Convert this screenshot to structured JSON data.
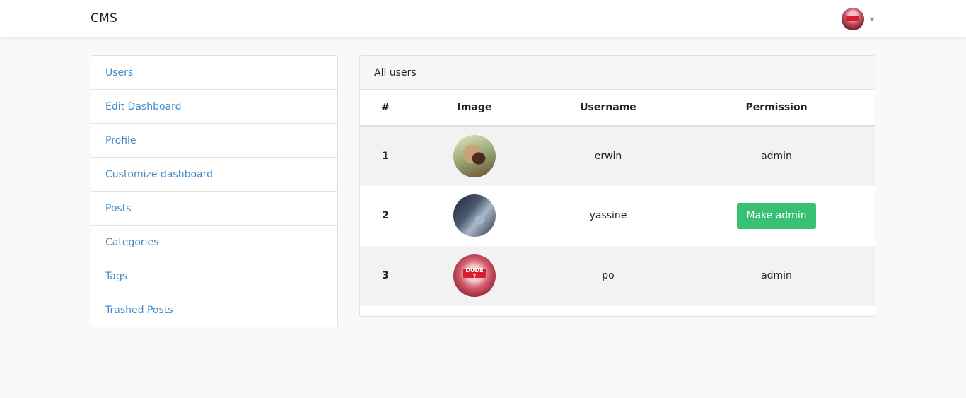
{
  "navbar": {
    "brand": "CMS",
    "user_avatar_icon": "user-avatar",
    "dropdown_icon": "caret-down-icon"
  },
  "sidebar": {
    "items": [
      {
        "label": "Users"
      },
      {
        "label": "Edit Dashboard"
      },
      {
        "label": "Profile"
      },
      {
        "label": "Customize dashboard"
      },
      {
        "label": "Posts"
      },
      {
        "label": "Categories"
      },
      {
        "label": "Tags"
      },
      {
        "label": "Trashed Posts"
      }
    ]
  },
  "main": {
    "card_title": "All users",
    "columns": [
      "#",
      "Image",
      "Username",
      "Permission"
    ],
    "rows": [
      {
        "index": "1",
        "username": "erwin",
        "permission": "admin"
      },
      {
        "index": "2",
        "username": "yassine",
        "permission": "Make admin"
      },
      {
        "index": "3",
        "username": "po",
        "permission": "admin",
        "avatar_text": "DUDE ?"
      }
    ]
  },
  "colors": {
    "link": "#3f89c8",
    "success": "#38c172",
    "page_bg": "#f8f9fa",
    "striped_row": "#f2f2f2"
  }
}
